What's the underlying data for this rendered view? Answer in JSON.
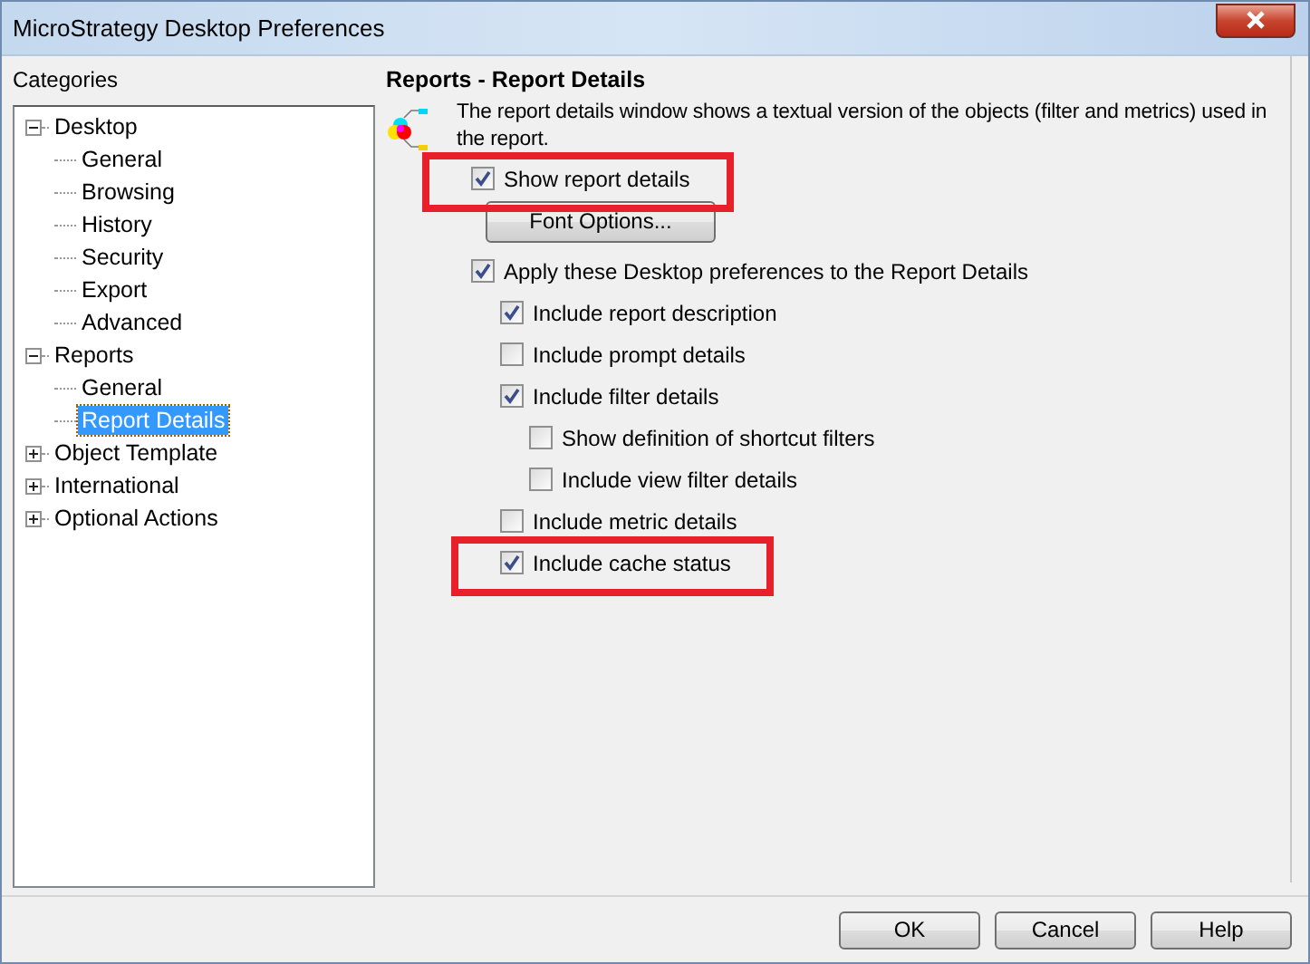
{
  "window": {
    "title": "MicroStrategy Desktop Preferences"
  },
  "categories": {
    "label": "Categories",
    "items": [
      {
        "label": "Desktop",
        "expanded": true,
        "selected": false,
        "children": [
          {
            "label": "General",
            "selected": false
          },
          {
            "label": "Browsing",
            "selected": false
          },
          {
            "label": "History",
            "selected": false
          },
          {
            "label": "Security",
            "selected": false
          },
          {
            "label": "Export",
            "selected": false
          },
          {
            "label": "Advanced",
            "selected": false
          }
        ]
      },
      {
        "label": "Reports",
        "expanded": true,
        "selected": false,
        "children": [
          {
            "label": "General",
            "selected": false
          },
          {
            "label": "Report Details",
            "selected": true
          }
        ]
      },
      {
        "label": "Object Template",
        "expanded": false,
        "selected": false
      },
      {
        "label": "International",
        "expanded": false,
        "selected": false
      },
      {
        "label": "Optional Actions",
        "expanded": false,
        "selected": false
      }
    ]
  },
  "panel": {
    "title": "Reports - Report Details",
    "description": "The report details window shows a textual version of the objects (filter and metrics) used in the report.",
    "options": [
      {
        "kind": "checkbox",
        "label": "Show report details",
        "checked": true,
        "highlighted": true
      },
      {
        "kind": "button",
        "label": "Font Options..."
      },
      {
        "kind": "checkbox",
        "label": "Apply these Desktop preferences to the Report Details",
        "checked": true,
        "highlighted": false,
        "children": [
          {
            "kind": "checkbox",
            "label": "Include report description",
            "checked": true,
            "highlighted": false
          },
          {
            "kind": "checkbox",
            "label": "Include prompt details",
            "checked": false,
            "highlighted": false
          },
          {
            "kind": "checkbox",
            "label": "Include filter details",
            "checked": true,
            "highlighted": false,
            "children": [
              {
                "kind": "checkbox",
                "label": "Show definition of shortcut filters",
                "checked": false,
                "highlighted": false
              },
              {
                "kind": "checkbox",
                "label": "Include view filter details",
                "checked": false,
                "highlighted": false
              }
            ]
          },
          {
            "kind": "checkbox",
            "label": "Include metric details",
            "checked": false,
            "highlighted": false
          },
          {
            "kind": "checkbox",
            "label": "Include cache status",
            "checked": true,
            "highlighted": true
          }
        ]
      }
    ]
  },
  "buttons": [
    "OK",
    "Cancel",
    "Help"
  ]
}
